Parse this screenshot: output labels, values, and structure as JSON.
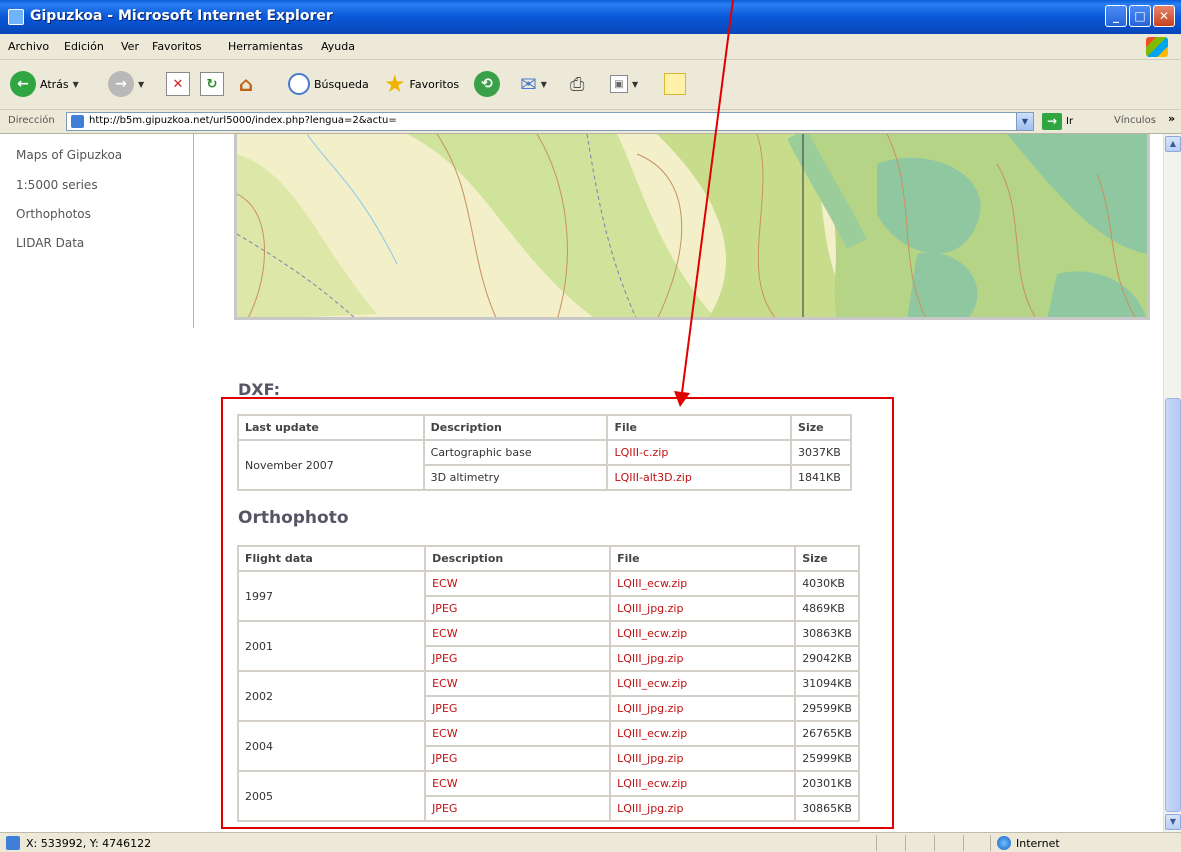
{
  "window": {
    "title": "Gipuzkoa - Microsoft Internet Explorer"
  },
  "menu": [
    "Archivo",
    "Edición",
    "Ver",
    "Favoritos",
    "Herramientas",
    "Ayuda"
  ],
  "toolbar": {
    "back_label": "Atrás",
    "search_label": "Búsqueda",
    "favorites_label": "Favoritos"
  },
  "address": {
    "label": "Dirección",
    "url": "http://b5m.gipuzkoa.net/url5000/index.php?lengua=2&actu=",
    "go_label": "Ir",
    "links_label": "Vínculos"
  },
  "sidebar": {
    "items": [
      "Maps of Gipuzkoa",
      "1:5000 series",
      "Orthophotos",
      "LIDAR Data"
    ]
  },
  "dxf": {
    "title": "DXF:",
    "headers": [
      "Last update",
      "Description",
      "File",
      "Size"
    ],
    "date": "November 2007",
    "rows": [
      {
        "description": "Cartographic base",
        "file": "LQIII-c.zip",
        "size": "3037KB"
      },
      {
        "description": "3D altimetry",
        "file": "LQIII-alt3D.zip",
        "size": "1841KB"
      }
    ]
  },
  "ortho": {
    "title": "Orthophoto",
    "headers": [
      "Flight data",
      "Description",
      "File",
      "Size"
    ],
    "flights": [
      {
        "year": "1997",
        "rows": [
          {
            "format": "ECW",
            "file": "LQIII_ecw.zip",
            "size": "4030KB"
          },
          {
            "format": "JPEG",
            "file": "LQIII_jpg.zip",
            "size": "4869KB"
          }
        ]
      },
      {
        "year": "2001",
        "rows": [
          {
            "format": "ECW",
            "file": "LQIII_ecw.zip",
            "size": "30863KB"
          },
          {
            "format": "JPEG",
            "file": "LQIII_jpg.zip",
            "size": "29042KB"
          }
        ]
      },
      {
        "year": "2002",
        "rows": [
          {
            "format": "ECW",
            "file": "LQIII_ecw.zip",
            "size": "31094KB"
          },
          {
            "format": "JPEG",
            "file": "LQIII_jpg.zip",
            "size": "29599KB"
          }
        ]
      },
      {
        "year": "2004",
        "rows": [
          {
            "format": "ECW",
            "file": "LQIII_ecw.zip",
            "size": "26765KB"
          },
          {
            "format": "JPEG",
            "file": "LQIII_jpg.zip",
            "size": "25999KB"
          }
        ]
      },
      {
        "year": "2005",
        "rows": [
          {
            "format": "ECW",
            "file": "LQIII_ecw.zip",
            "size": "20301KB"
          },
          {
            "format": "JPEG",
            "file": "LQIII_jpg.zip",
            "size": "30865KB"
          }
        ]
      }
    ]
  },
  "status": {
    "coords": "X: 533992, Y: 4746122",
    "zone": "Internet"
  },
  "colors": {
    "link": "#c01010",
    "titlebar": "#0a58d8",
    "chrome": "#ece9d8",
    "annotation": "#e00000"
  }
}
